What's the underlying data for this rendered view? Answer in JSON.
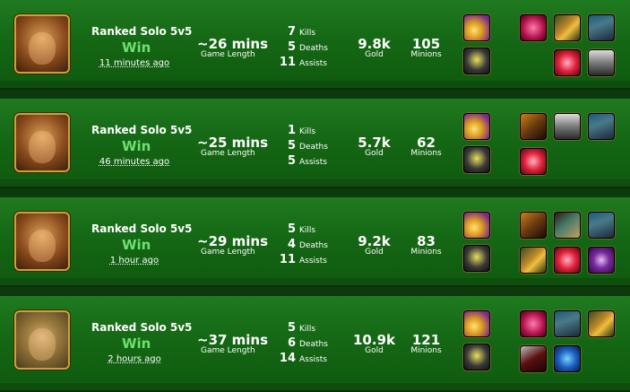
{
  "matches": [
    {
      "champion_icon": "champion-portrait-warrior",
      "queue": "Ranked Solo 5v5",
      "result": "Win",
      "time_ago": "11 minutes ago",
      "length": "~26 mins",
      "length_label": "Game Length",
      "kills": "7",
      "kills_label": "Kills",
      "deaths": "5",
      "deaths_label": "Deaths",
      "assists": "11",
      "assists_label": "Assists",
      "gold": "9.8k",
      "gold_label": "Gold",
      "minions": "105",
      "minions_label": "Minions",
      "spells": [
        "flash-spell-icon",
        "exhaust-spell-icon"
      ],
      "items": [
        "crimson-item-icon",
        "blade-item-icon",
        "boots-item-icon",
        "ruby-item-icon",
        "armor-item-icon"
      ]
    },
    {
      "champion_icon": "champion-portrait-warrior",
      "queue": "Ranked Solo 5v5",
      "result": "Win",
      "time_ago": "46 minutes ago",
      "length": "~25 mins",
      "length_label": "Game Length",
      "kills": "1",
      "kills_label": "Kills",
      "deaths": "5",
      "deaths_label": "Deaths",
      "assists": "5",
      "assists_label": "Assists",
      "gold": "5.7k",
      "gold_label": "Gold",
      "minions": "62",
      "minions_label": "Minions",
      "spells": [
        "flash-spell-icon",
        "exhaust-spell-icon"
      ],
      "items": [
        "gauntlet-item-icon",
        "armor-item-icon",
        "boots-item-icon",
        "ruby-item-icon"
      ]
    },
    {
      "champion_icon": "champion-portrait-warrior",
      "queue": "Ranked Solo 5v5",
      "result": "Win",
      "time_ago": "1 hour ago",
      "length": "~29 mins",
      "length_label": "Game Length",
      "kills": "5",
      "kills_label": "Kills",
      "deaths": "4",
      "deaths_label": "Deaths",
      "assists": "11",
      "assists_label": "Assists",
      "gold": "9.2k",
      "gold_label": "Gold",
      "minions": "83",
      "minions_label": "Minions",
      "spells": [
        "flash-spell-icon",
        "exhaust-spell-icon"
      ],
      "items": [
        "gauntlet-item-icon",
        "mask-item-icon",
        "boots-item-icon",
        "blade-item-icon",
        "ruby-item-icon",
        "eye-item-icon"
      ]
    },
    {
      "champion_icon": "champion-portrait-golden-helm",
      "queue": "Ranked Solo 5v5",
      "result": "Win",
      "time_ago": "2 hours ago",
      "length": "~37 mins",
      "length_label": "Game Length",
      "kills": "5",
      "kills_label": "Kills",
      "deaths": "6",
      "deaths_label": "Deaths",
      "assists": "14",
      "assists_label": "Assists",
      "gold": "10.9k",
      "gold_label": "Gold",
      "minions": "121",
      "minions_label": "Minions",
      "spells": [
        "flash-spell-icon",
        "exhaust-spell-icon"
      ],
      "items": [
        "crimson-item-icon",
        "boots-item-icon",
        "blade-item-icon",
        "mace-item-icon",
        "flame-item-icon"
      ]
    }
  ]
}
